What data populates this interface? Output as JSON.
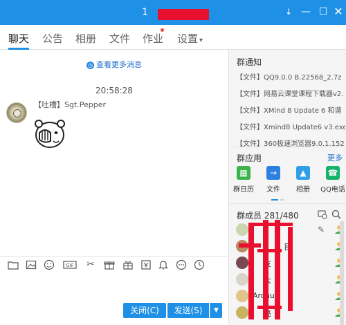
{
  "window": {
    "title_visible": "1",
    "controls": [
      "↓",
      "—",
      "☐",
      "✕"
    ]
  },
  "tabs": [
    {
      "label": "聊天"
    },
    {
      "label": "公告"
    },
    {
      "label": "相册"
    },
    {
      "label": "文件"
    },
    {
      "label": "作业"
    },
    {
      "label": "设置",
      "caret": "▾"
    }
  ],
  "chat": {
    "more_messages": "查看更多消息",
    "timestamp": "20:58:28",
    "sender": "【吐槽】Sgt.Pepper"
  },
  "toolbar_icons": [
    "folder-icon",
    "image-icon",
    "emoji-icon",
    "gif-icon",
    "scissors-icon",
    "gift-box-icon",
    "present-icon",
    "voucher-icon",
    "bell-icon",
    "more-icon",
    "clock-icon"
  ],
  "buttons": {
    "close": "关闭(C)",
    "send": "发送(S)",
    "dropdown": "▼"
  },
  "notice": {
    "title": "群通知",
    "items": [
      "【文件】QQ9.0.0 B.22568_2.7z",
      "【文件】网易云课堂课程下载器v2.",
      "【文件】XMind 8 Update 6 和谐",
      "【文件】Xmind8 Update6 v3.exe",
      "【文件】360极速浏览器9.0.1.152"
    ]
  },
  "apps": {
    "title": "群应用",
    "more": "更多",
    "items": [
      {
        "label": "群日历",
        "color": "#3bb54a",
        "glyph": "▦"
      },
      {
        "label": "文件",
        "color": "#2d7fe0",
        "glyph": "→"
      },
      {
        "label": "相册",
        "color": "#2ea0e8",
        "glyph": "▲"
      },
      {
        "label": "QQ电话",
        "color": "#17b26b",
        "glyph": "☎"
      }
    ]
  },
  "members": {
    "title": "群成员 281/480",
    "list": [
      {
        "name": ""
      },
      {
        "name": "回"
      },
      {
        "name": "友"
      },
      {
        "name": "大"
      },
      {
        "name": "Archu"
      },
      {
        "name": "亮"
      }
    ]
  }
}
